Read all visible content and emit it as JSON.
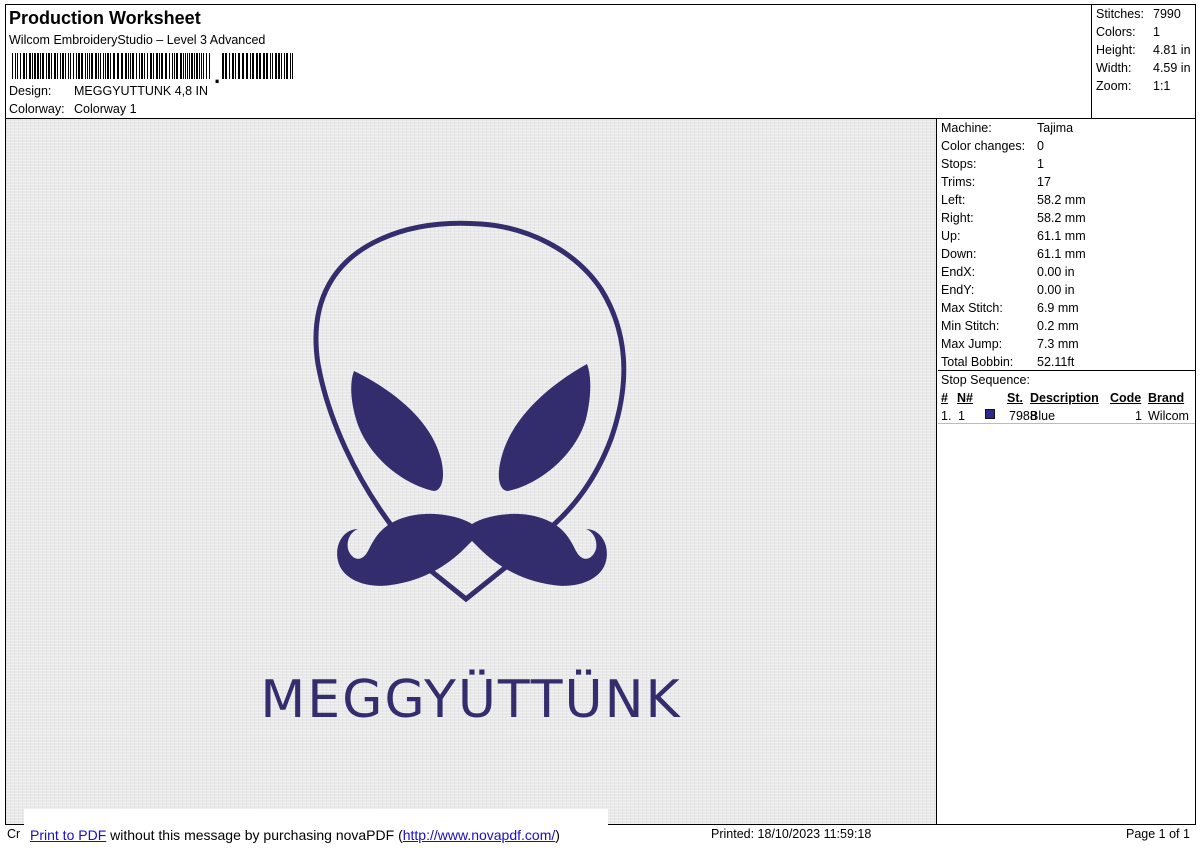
{
  "header": {
    "title": "Production Worksheet",
    "subtitle": "Wilcom EmbroideryStudio – Level 3 Advanced",
    "design_label": "Design:",
    "design_value": "MEGGYUTTUNK 4,8 IN",
    "colorway_label": "Colorway:",
    "colorway_value": "Colorway 1"
  },
  "summary": [
    {
      "label": "Stitches:",
      "value": "7990"
    },
    {
      "label": "Colors:",
      "value": "1"
    },
    {
      "label": "Height:",
      "value": "4.81 in"
    },
    {
      "label": "Width:",
      "value": "4.59 in"
    },
    {
      "label": "Zoom:",
      "value": "1:1"
    }
  ],
  "properties": [
    {
      "label": "Machine:",
      "value": "Tajima"
    },
    {
      "label": "Color changes:",
      "value": "0"
    },
    {
      "label": "Stops:",
      "value": "1"
    },
    {
      "label": "Trims:",
      "value": "17"
    },
    {
      "label": "Left:",
      "value": "58.2 mm"
    },
    {
      "label": "Right:",
      "value": "58.2 mm"
    },
    {
      "label": "Up:",
      "value": "61.1 mm"
    },
    {
      "label": "Down:",
      "value": "61.1 mm"
    },
    {
      "label": "EndX:",
      "value": "0.00 in"
    },
    {
      "label": "EndY:",
      "value": "0.00 in"
    },
    {
      "label": "Max Stitch:",
      "value": "6.9 mm"
    },
    {
      "label": "Min Stitch:",
      "value": "0.2 mm"
    },
    {
      "label": "Max Jump:",
      "value": "7.3 mm"
    },
    {
      "label": "Total Bobbin:",
      "value": "52.11ft"
    }
  ],
  "stop_sequence": {
    "title": "Stop Sequence:",
    "headers": {
      "num": "#",
      "needle": "N#",
      "st": "St.",
      "description": "Description",
      "code": "Code",
      "brand": "Brand"
    },
    "rows": [
      {
        "num": "1.",
        "needle": "1",
        "st": "7988",
        "description": "Blue",
        "code": "1",
        "brand": "Wilcom",
        "color": "#2d2a8a"
      }
    ]
  },
  "design": {
    "text": "MEGGYÜTTÜNK",
    "thread_color": "#332d6e"
  },
  "footer": {
    "left": "Cr",
    "nova_link": "Print to PDF",
    "nova_middle": " without this message by purchasing novaPDF (",
    "nova_url": "http://www.novapdf.com/",
    "nova_end": ")",
    "printed": "Printed: 18/10/2023 11:59:18",
    "page": "Page 1 of 1"
  }
}
